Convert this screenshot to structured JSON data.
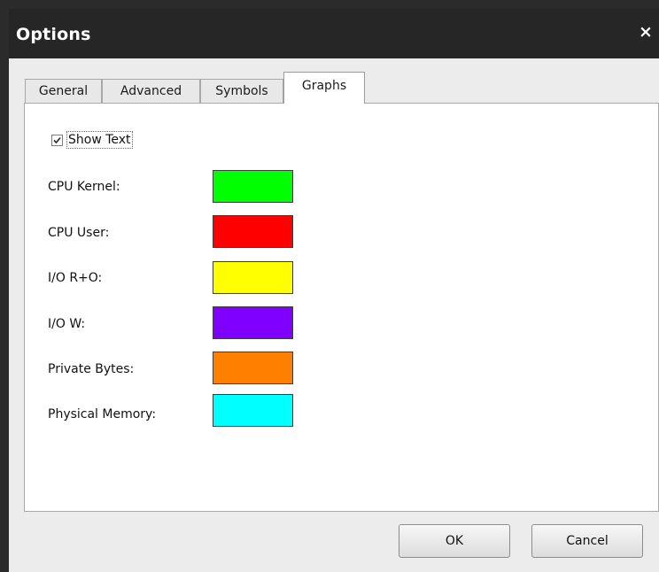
{
  "window": {
    "title": "Options",
    "close_glyph": "×"
  },
  "tabs": [
    {
      "label": "General",
      "active": false
    },
    {
      "label": "Advanced",
      "active": false
    },
    {
      "label": "Symbols",
      "active": false
    },
    {
      "label": "Graphs",
      "active": true
    }
  ],
  "graphs": {
    "show_text": {
      "label": "Show Text",
      "checked": true
    },
    "colors": [
      {
        "label": "CPU Kernel:",
        "color": "#00ff00"
      },
      {
        "label": "CPU User:",
        "color": "#ff0000"
      },
      {
        "label": "I/O R+O:",
        "color": "#ffff00"
      },
      {
        "label": "I/O W:",
        "color": "#8000ff"
      },
      {
        "label": "Private Bytes:",
        "color": "#ff8000"
      },
      {
        "label": "Physical Memory:",
        "color": "#00ffff"
      }
    ]
  },
  "buttons": {
    "ok": "OK",
    "cancel": "Cancel"
  }
}
